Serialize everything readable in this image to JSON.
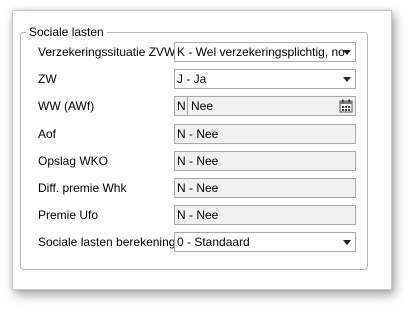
{
  "group": {
    "title": "Sociale lasten"
  },
  "rows": [
    {
      "label": "Verzekeringssituatie ZVW",
      "value": "K - Wel verzekeringsplichtig, no"
    },
    {
      "label": "ZW",
      "value": "J - Ja"
    },
    {
      "label": "WW (AWf)",
      "code": "N",
      "value": "Nee",
      "icon": "calendar-lookup-icon"
    },
    {
      "label": "Aof",
      "value": "N - Nee"
    },
    {
      "label": "Opslag WKO",
      "value": "N - Nee"
    },
    {
      "label": "Diff. premie Whk",
      "value": "N - Nee"
    },
    {
      "label": "Premie Ufo",
      "value": "N - Nee"
    },
    {
      "label": "Sociale lasten berekening",
      "value": "0 - Standaard"
    }
  ]
}
